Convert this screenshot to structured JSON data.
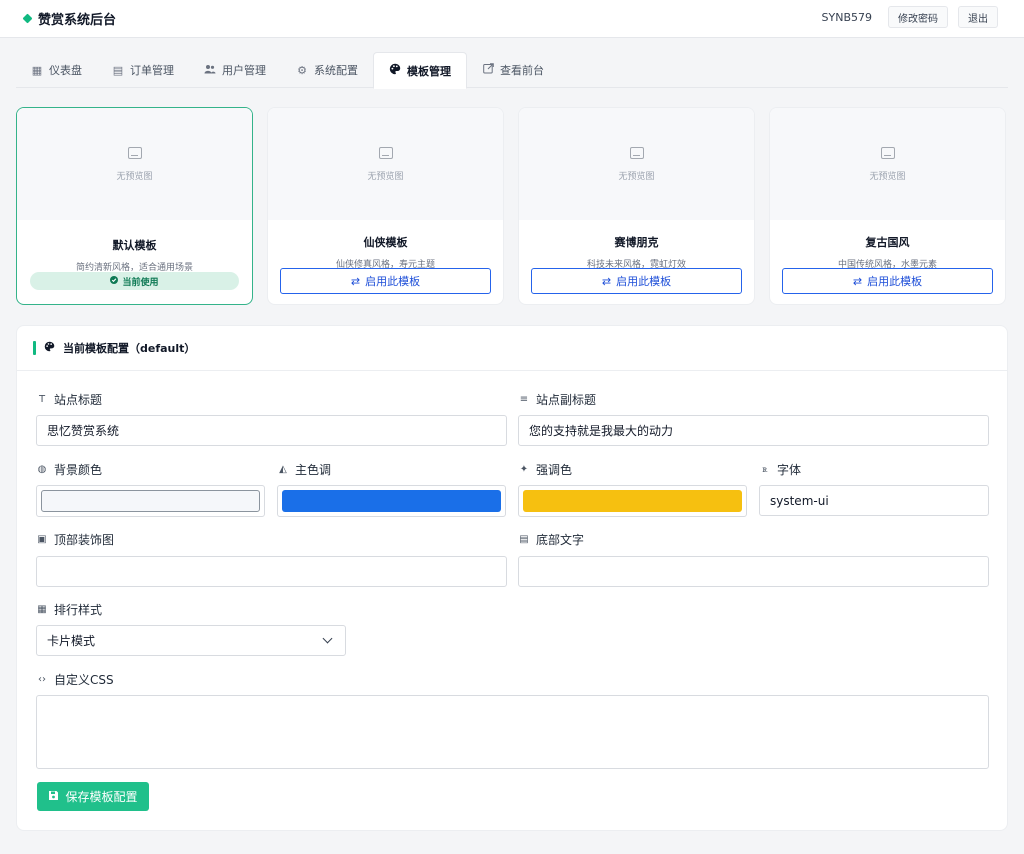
{
  "app": {
    "title": "赞赏系统后台"
  },
  "header": {
    "username": "SYNB579",
    "change_password": "修改密码",
    "logout": "退出"
  },
  "tabs": [
    {
      "label": "仪表盘",
      "icon": "dashboard-icon"
    },
    {
      "label": "订单管理",
      "icon": "clipboard-icon"
    },
    {
      "label": "用户管理",
      "icon": "users-icon"
    },
    {
      "label": "系统配置",
      "icon": "gear-icon"
    },
    {
      "label": "模板管理",
      "icon": "palette-icon",
      "active": true
    },
    {
      "label": "查看前台",
      "icon": "external-link-icon"
    }
  ],
  "templates": [
    {
      "title": "默认模板",
      "desc": "简约清新风格，适合通用场景",
      "preview": "无预览图",
      "status": "当前使用",
      "active": true
    },
    {
      "title": "仙侠模板",
      "desc": "仙侠修真风格，寿元主题",
      "preview": "无预览图",
      "action": "启用此模板"
    },
    {
      "title": "赛博朋克",
      "desc": "科技未来风格，霓虹灯效",
      "preview": "无预览图",
      "action": "启用此模板"
    },
    {
      "title": "复古国风",
      "desc": "中国传统风格，水墨元素",
      "preview": "无预览图",
      "action": "启用此模板"
    }
  ],
  "config": {
    "heading": "当前模板配置（default）",
    "site_title": {
      "label": "站点标题",
      "value": "思忆赞赏系统"
    },
    "site_subtitle": {
      "label": "站点副标题",
      "value": "您的支持就是我最大的动力"
    },
    "bg_color": {
      "label": "背景颜色",
      "color": "#f5f7fa"
    },
    "primary_color": {
      "label": "主色调",
      "color": "#1a6fe8"
    },
    "accent_color": {
      "label": "强调色",
      "color": "#f6c010"
    },
    "font": {
      "label": "字体",
      "value": "system-ui"
    },
    "header_image": {
      "label": "顶部装饰图",
      "value": ""
    },
    "footer_text": {
      "label": "底部文字",
      "value": ""
    },
    "ranking_style": {
      "label": "排行样式",
      "value": "卡片模式"
    },
    "custom_css": {
      "label": "自定义CSS",
      "value": ""
    },
    "save_label": "保存模板配置"
  },
  "colors": {
    "accent": "#10b981",
    "primary_button": "#20c08b",
    "link_blue": "#2563eb"
  }
}
